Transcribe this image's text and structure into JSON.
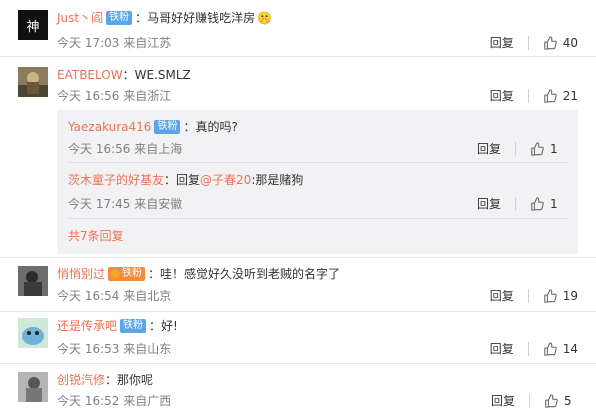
{
  "comments": [
    {
      "username": "Just丶阎",
      "badge": "铁粉",
      "text": "马哥好好赚钱吃洋房",
      "emoji": "🤫",
      "meta": "今天 17:03 来自江苏",
      "reply": "回复",
      "likes": "40",
      "avatar_text": "神"
    },
    {
      "username": "EATBELOW",
      "text": "WE.SMLZ",
      "meta": "今天 16:56 来自浙江",
      "reply": "回复",
      "likes": "21"
    },
    {
      "username": "悄悄别过",
      "badge": "铁粉",
      "text": "哇！感觉好久没听到老贼的名字了",
      "meta": "今天 16:54 来自北京",
      "reply": "回复",
      "likes": "19"
    },
    {
      "username": "还是传承吧",
      "badge": "铁粉",
      "text": "好!",
      "meta": "今天 16:53 来自山东",
      "reply": "回复",
      "likes": "14"
    },
    {
      "username": "创锐汽修",
      "text": "那你呢",
      "meta": "今天 16:52 来自广西",
      "reply": "回复",
      "likes": "5"
    }
  ],
  "subreplies": [
    {
      "username": "Yaezakura416",
      "badge": "铁粉",
      "text": "真的吗?",
      "meta": "今天 16:56 来自上海",
      "reply": "回复",
      "likes": "1"
    },
    {
      "username": "茨木童子的好基友",
      "reply_prefix": "回复",
      "mention": "@子春20",
      "text": ":那是赌狗",
      "meta": "今天 17:45 来自安徽",
      "reply": "回复",
      "likes": "1"
    }
  ],
  "more_replies": "共7条回复",
  "colors": {
    "username": "#eb7350",
    "badge": "#5aa6e6",
    "meta": "#808080",
    "panel": "#f2f2f5"
  }
}
